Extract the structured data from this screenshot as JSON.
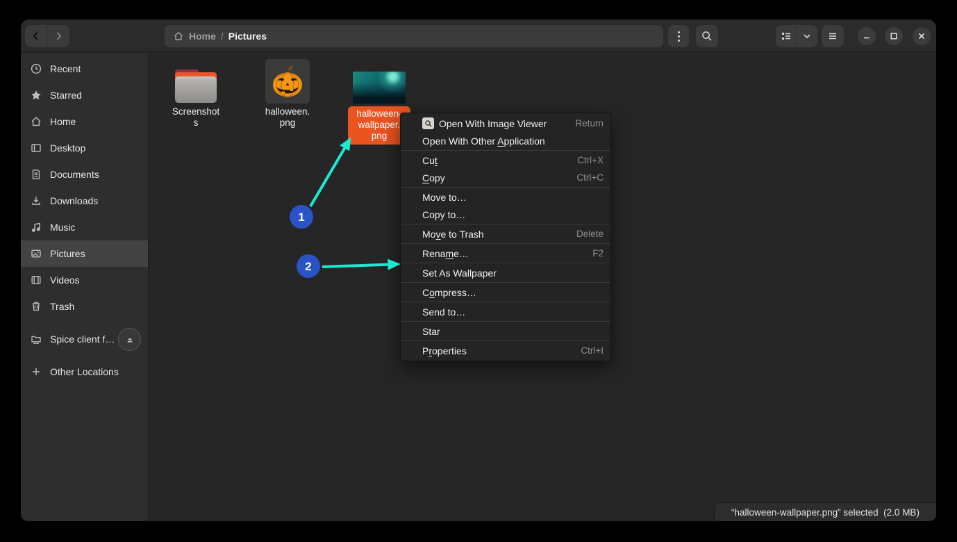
{
  "header": {
    "breadcrumb": {
      "root": "Home",
      "separator": "/",
      "current": "Pictures"
    }
  },
  "sidebar": {
    "items": [
      {
        "label": "Recent"
      },
      {
        "label": "Starred"
      },
      {
        "label": "Home"
      },
      {
        "label": "Desktop"
      },
      {
        "label": "Documents"
      },
      {
        "label": "Downloads"
      },
      {
        "label": "Music"
      },
      {
        "label": "Pictures",
        "state": "selected"
      },
      {
        "label": "Videos"
      },
      {
        "label": "Trash"
      }
    ],
    "device": {
      "label": "Spice client f…"
    },
    "other_locations": {
      "label": "Other Locations"
    }
  },
  "files": {
    "folder": {
      "name": "Screenshots",
      "lines": [
        "Screenshot",
        "s"
      ]
    },
    "image1": {
      "name": "halloween.png",
      "lines": [
        "halloween.",
        "png"
      ]
    },
    "image2": {
      "name": "halloween-wallpaper.png",
      "lines": [
        "halloween-",
        "wallpaper.",
        "png"
      ],
      "state": "selected"
    }
  },
  "menu": {
    "items": [
      {
        "pre": "Open With Image Viewer",
        "u": "",
        "post": "",
        "shortcut": "Return"
      },
      {
        "pre": "Open With Other ",
        "u": "A",
        "post": "pplication",
        "shortcut": ""
      },
      {
        "pre": "Cu",
        "u": "t",
        "post": "",
        "shortcut": "Ctrl+X"
      },
      {
        "pre": "",
        "u": "C",
        "post": "opy",
        "shortcut": "Ctrl+C"
      },
      {
        "pre": "Move to…",
        "u": "",
        "post": "",
        "shortcut": ""
      },
      {
        "pre": "Copy to…",
        "u": "",
        "post": "",
        "shortcut": ""
      },
      {
        "pre": "Mo",
        "u": "v",
        "post": "e to Trash",
        "shortcut": "Delete"
      },
      {
        "pre": "Rena",
        "u": "m",
        "post": "e…",
        "shortcut": "F2"
      },
      {
        "pre": "Set As Wallpaper",
        "u": "",
        "post": "",
        "shortcut": ""
      },
      {
        "pre": "C",
        "u": "o",
        "post": "mpress…",
        "shortcut": ""
      },
      {
        "pre": "Send to…",
        "u": "",
        "post": "",
        "shortcut": ""
      },
      {
        "pre": "Star",
        "u": "",
        "post": "",
        "shortcut": ""
      },
      {
        "pre": "P",
        "u": "r",
        "post": "operties",
        "shortcut": "Ctrl+I"
      }
    ]
  },
  "statusbar": {
    "text": "“halloween-wallpaper.png” selected  (2.0 MB)"
  },
  "annotations": {
    "step1": "1",
    "step2": "2"
  },
  "colors": {
    "selection_orange": "#e95420",
    "annotation_blue": "#2b53c8",
    "annotation_cyan": "#1de9d2"
  }
}
